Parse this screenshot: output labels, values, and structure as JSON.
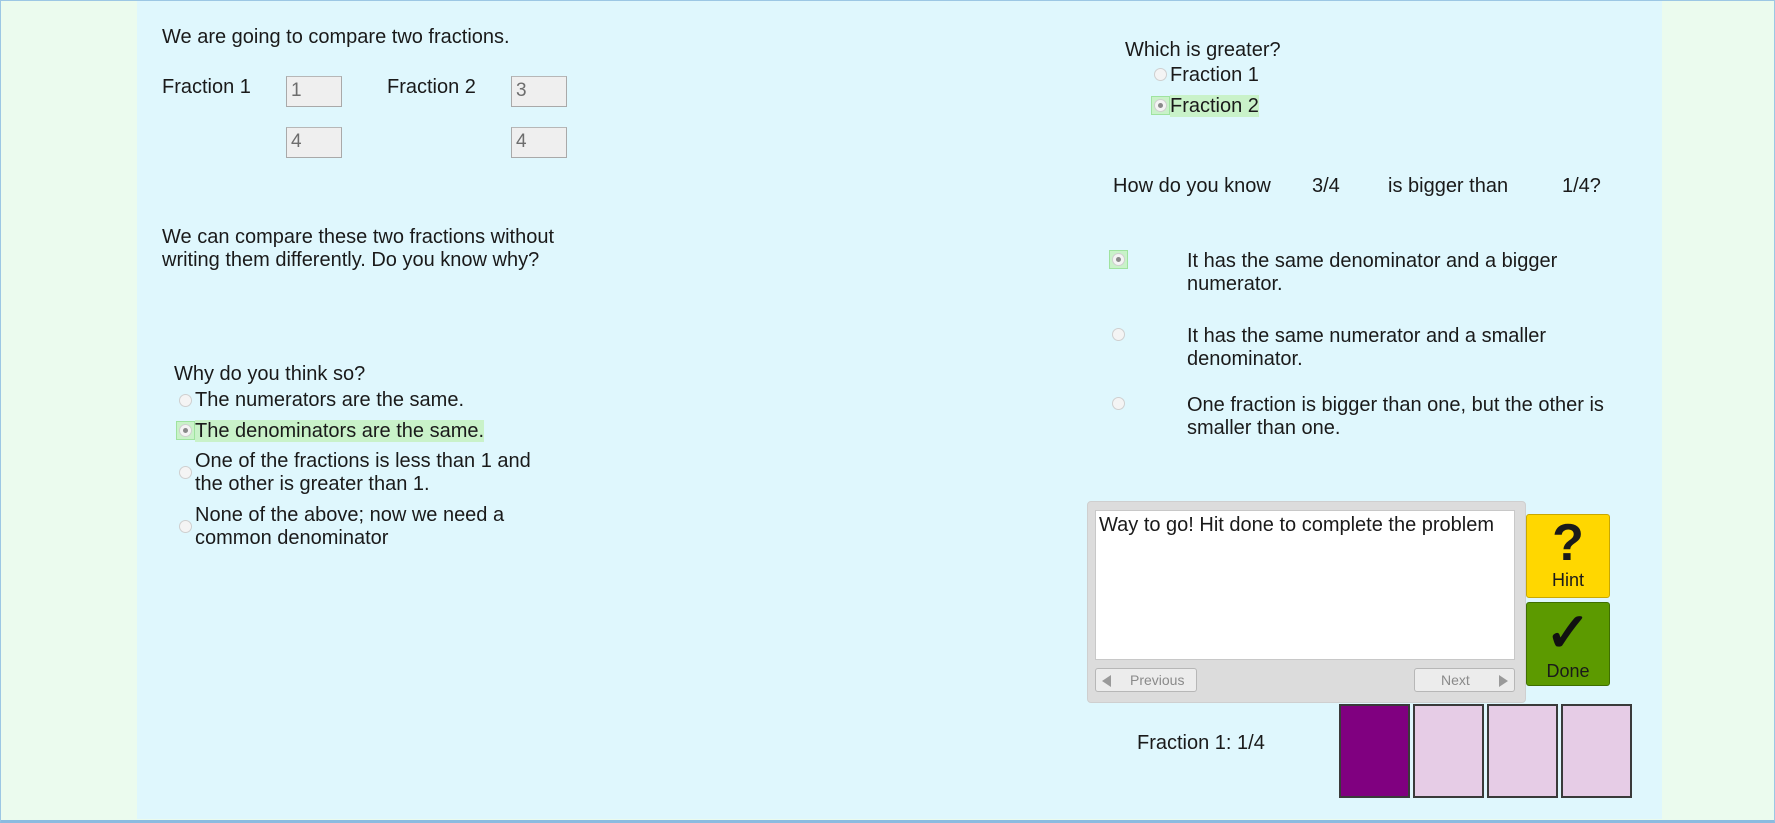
{
  "intro": "We are going to compare two fractions.",
  "fraction1": {
    "label": "Fraction 1",
    "numerator": "1",
    "denominator": "4"
  },
  "fraction2": {
    "label": "Fraction 2",
    "numerator": "3",
    "denominator": "4"
  },
  "compare_text_line1": "We can compare these two fractions without",
  "compare_text_line2": "writing them differently. Do you know why?",
  "why_question": "Why do you think so?",
  "why_options": [
    {
      "text": "The numerators are the same.",
      "checked": false
    },
    {
      "text": "The denominators are the same.",
      "checked": true
    },
    {
      "line1": "One of the fractions is less than 1 and",
      "line2": "the other is greater than 1.",
      "checked": false
    },
    {
      "line1": "None of the above; now we need a",
      "line2": "common denominator",
      "checked": false
    }
  ],
  "greater_question": "Which is greater?",
  "greater_options": [
    {
      "text": "Fraction 1",
      "checked": false
    },
    {
      "text": "Fraction 2",
      "checked": true
    }
  ],
  "how": {
    "prefix": "How do you know",
    "first": "3/4",
    "middle": "is bigger than",
    "second": "1/4?"
  },
  "how_options": [
    {
      "line1": "It has the same denominator and a bigger",
      "line2": "numerator.",
      "checked": true
    },
    {
      "line1": "It has the same numerator and a smaller",
      "line2": "denominator.",
      "checked": false
    },
    {
      "line1": "One fraction is bigger than one, but the other is",
      "line2": "smaller than one.",
      "checked": false
    }
  ],
  "feedback": {
    "message": "Way to go! Hit done to complete the problem",
    "previous_label": "Previous",
    "next_label": "Next"
  },
  "hint_button": {
    "symbol": "?",
    "label": "Hint",
    "color": "#ffd700"
  },
  "done_button": {
    "symbol": "✓",
    "label": "Done",
    "color": "#5c9a00"
  },
  "fraction_bar": {
    "label": "Fraction 1: 1/4",
    "parts": 4,
    "filled": 1,
    "filled_color": "#800080",
    "empty_color": "#e6cce6"
  }
}
